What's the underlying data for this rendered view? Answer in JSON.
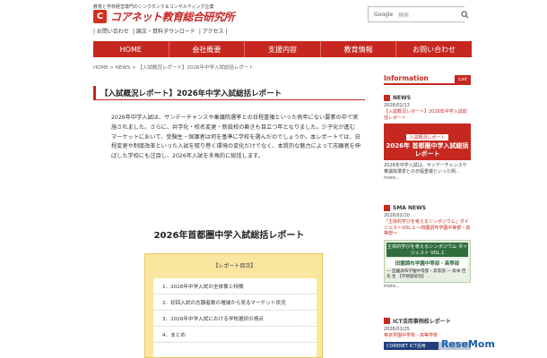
{
  "header": {
    "tagline": "教育と学校経営専門のシンクタンク＆コンサルティング企業",
    "logo_mark": "C",
    "logo_text": "コアネット教育総合研究所",
    "search_google": "Google",
    "search_placeholder": "検索",
    "subnav": [
      "| お問い合わせ",
      "| 論文・資料ダウンロード",
      "| アクセス |"
    ]
  },
  "mainnav": [
    "HOME",
    "会社概要",
    "支援内容",
    "教育情報",
    "お問い合わせ"
  ],
  "breadcrumb": "HOME > NEWS > 【入試概況レポート】2026年中学入試総括レポート",
  "article": {
    "title": "【入試概況レポート】2026年中学入試総括レポート",
    "body": "2026年中学入試は、サンデーチャンスや乗議院選挙との日程重複といった例年にない要素の中で実施されました。さらに、共学化・校名変更・新設校の動きも目立つ年となりました。少子化が進むマーケットにおいて、受験生・保護者は何を基準に学校を選んだのでしょうか。本レポートでは、日程変更や制度改革といった入試を取り巻く環境の変化だけでなく、本質的な魅力によって志願者を伸ばした学校にも注目し、2026年入試を多角的に総括します。",
    "report_heading": "2026年首都圏中学入試総括レポート",
    "toc_head": "【レポート目次】",
    "toc": [
      "1．2026年中学入試の全体像と特徴",
      "2．初回入試の志願者数の増減から見るマーケット状況",
      "3．2026年中学入試における学校選択の視点",
      "4．まとめ"
    ]
  },
  "sidebar": {
    "info_title": "Information",
    "list_label": "List",
    "news1": {
      "label": "NEWS",
      "date": "2026/02/13",
      "link": "【入試概況レポート】2026年中学入試総括レポート",
      "banner_small": "入試概況レポート",
      "banner_big": "2026年 首都圏中学入試総括レポート",
      "text": "2026年中学入試は、サンデーチャンスや乗議院選挙との日程重複といった例...",
      "more": "more..."
    },
    "news2": {
      "label": "SMA NEWS",
      "date": "2026/02/10",
      "link": "「主体的学びを考えるシンポジウム」ダイジェストVOL.1 ～田園調布学園中等部・高等部～",
      "banner_top": "主体的学びを考えるシンポジウム ダイジェスト VOL.1",
      "banner_school": "田園調布学園中等部・高等部",
      "banner_people": "一 田園調布学園中等部・高等部 一 坂本 佳先 生 【学務部統括】…",
      "more": "more..."
    },
    "news3": {
      "label": "ICT活用事例校レポート",
      "date": "2026/01/25",
      "link": "帝京学園中学校・高等学校",
      "banner": "CORENET ICT活用"
    }
  },
  "watermark": "ReseMom"
}
